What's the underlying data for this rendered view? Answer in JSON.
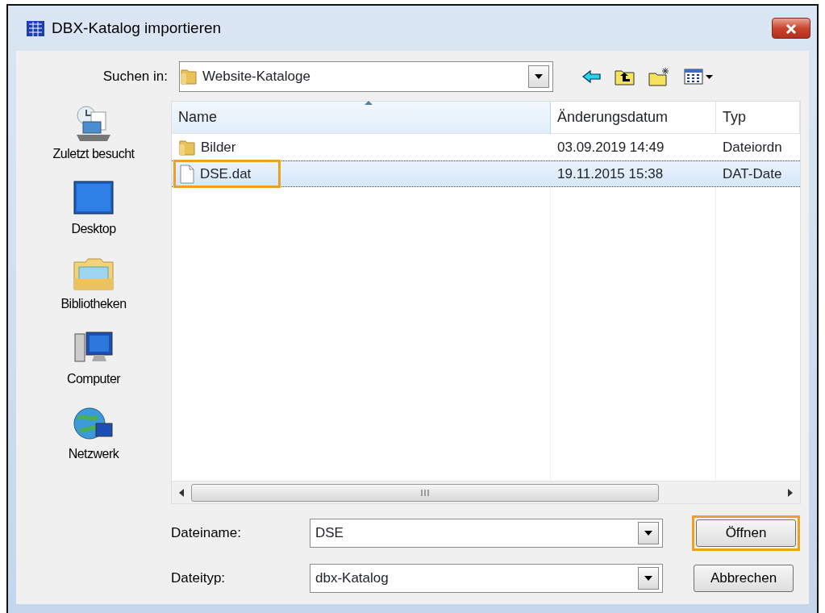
{
  "window": {
    "title": "DBX-Katalog importieren"
  },
  "look_in": {
    "label": "Suchen in:",
    "value": "Website-Kataloge"
  },
  "places": [
    {
      "label": "Zuletzt besucht",
      "kind": "recent"
    },
    {
      "label": "Desktop",
      "kind": "desktop"
    },
    {
      "label": "Bibliotheken",
      "kind": "library"
    },
    {
      "label": "Computer",
      "kind": "computer"
    },
    {
      "label": "Netzwerk",
      "kind": "network"
    }
  ],
  "columns": [
    {
      "label": "Name",
      "sorted": true
    },
    {
      "label": "Änderungsdatum",
      "sorted": false
    },
    {
      "label": "Typ",
      "sorted": false
    }
  ],
  "files": [
    {
      "kind": "folder",
      "name": "Bilder",
      "date": "03.09.2019 14:49",
      "type": "Dateiordn",
      "selected": false,
      "highlighted": false
    },
    {
      "kind": "file",
      "name": "DSE.dat",
      "date": "19.11.2015 15:38",
      "type": "DAT-Date",
      "selected": true,
      "highlighted": true
    }
  ],
  "filename": {
    "label": "Dateiname:",
    "value": "DSE"
  },
  "filetype": {
    "label": "Dateityp:",
    "value": "dbx-Katalog"
  },
  "buttons": [
    {
      "label": "Öffnen",
      "highlighted": true
    },
    {
      "label": "Abbrechen",
      "highlighted": false
    }
  ]
}
